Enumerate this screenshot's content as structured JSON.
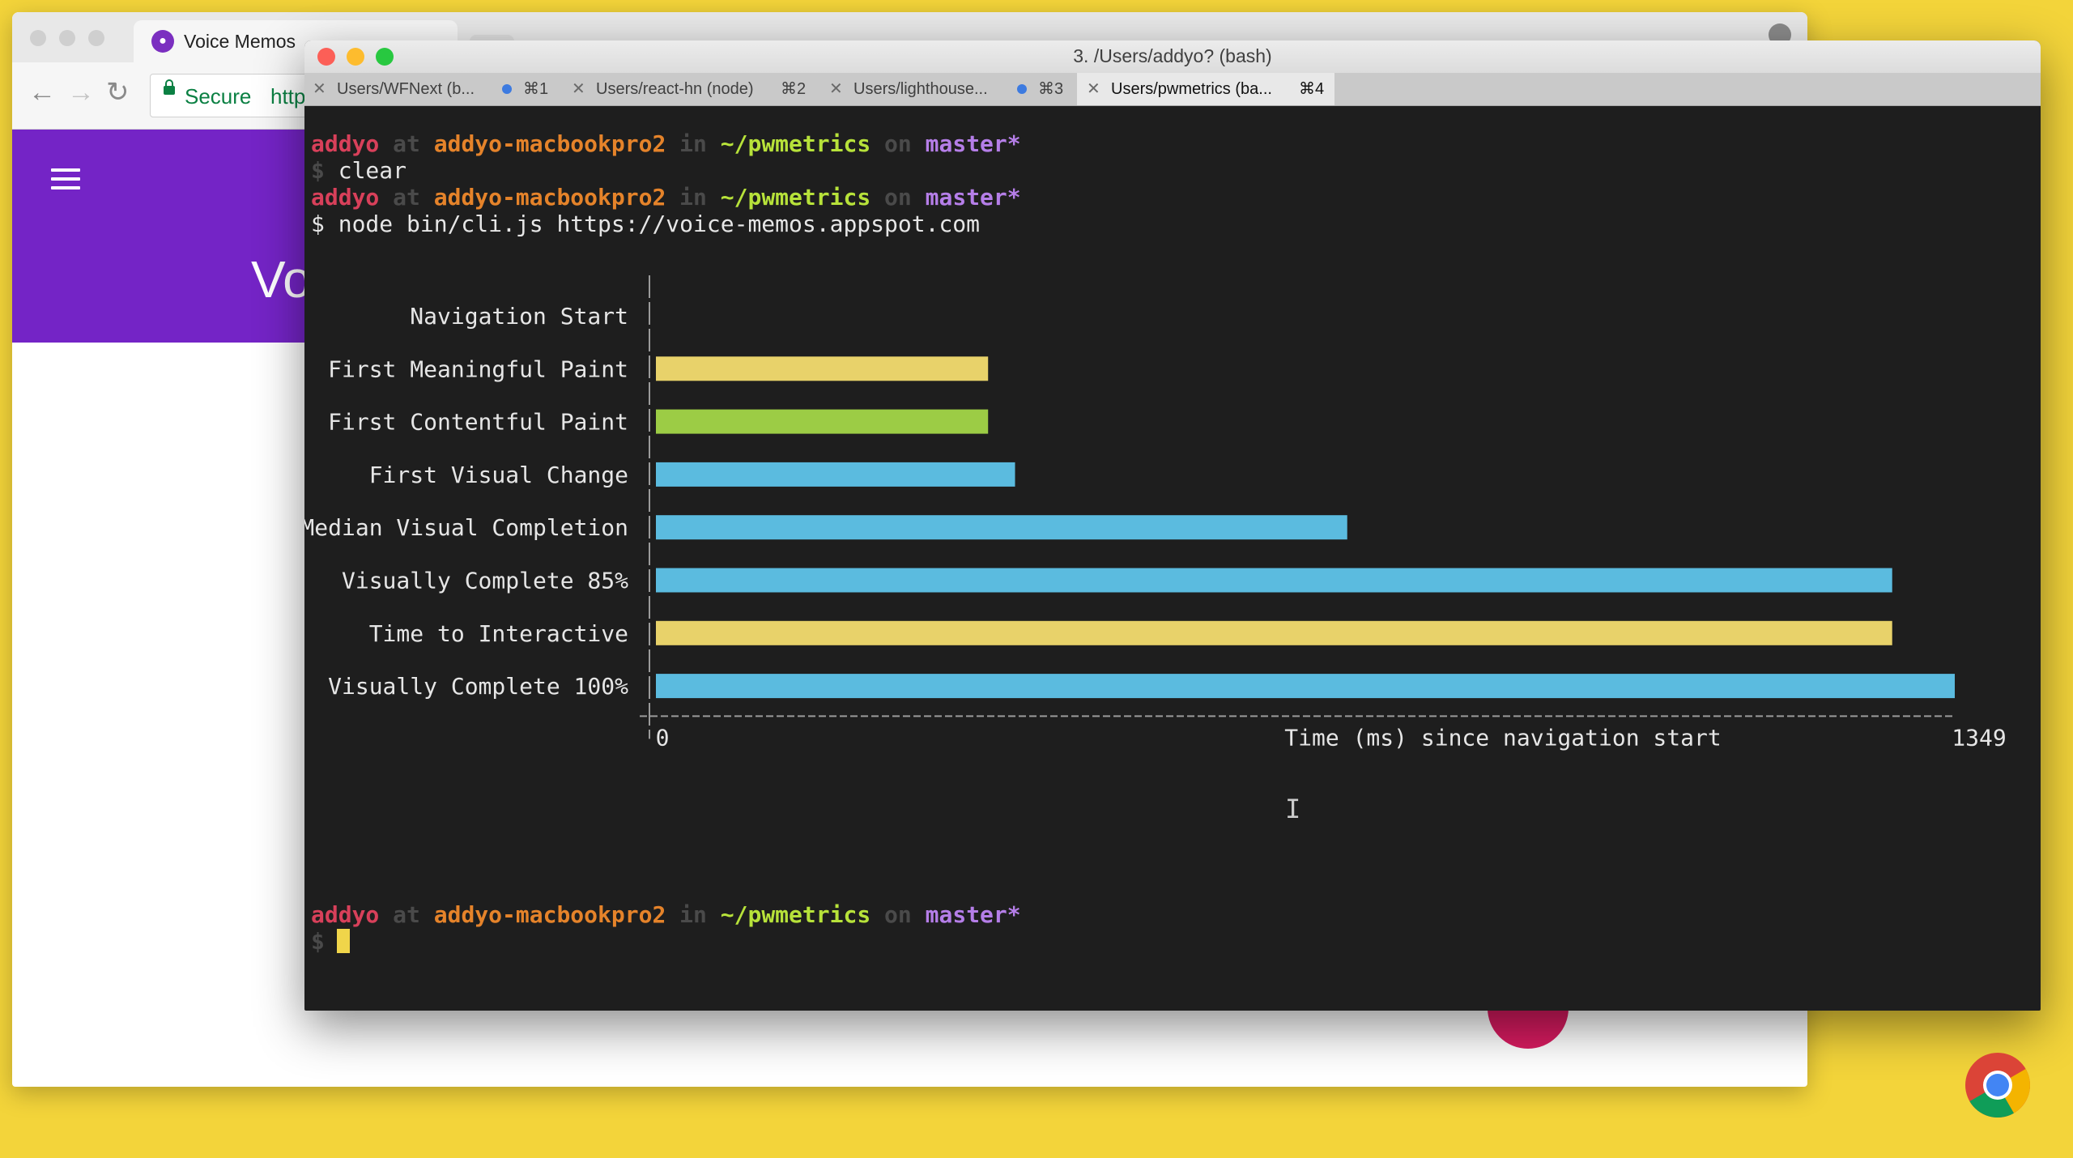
{
  "browser": {
    "tab_title": "Voice Memos",
    "secure_label": "Secure",
    "url_fragment": "http",
    "app_title_fragment": "Vo"
  },
  "terminal": {
    "window_title": "3. /Users/addyo? (bash)",
    "tabs": [
      {
        "label": "Users/WFNext (b...",
        "shortcut": "⌘1",
        "dot": true
      },
      {
        "label": "Users/react-hn (node)",
        "shortcut": "⌘2",
        "dot": false
      },
      {
        "label": "Users/lighthouse...",
        "shortcut": "⌘3",
        "dot": true
      },
      {
        "label": "Users/pwmetrics (ba...",
        "shortcut": "⌘4",
        "dot": false
      }
    ],
    "prompt": {
      "user": "addyo",
      "at": "at",
      "host": "addyo-macbookpro2",
      "in": "in",
      "dir": "~/pwmetrics",
      "on": "on",
      "branch": "master*",
      "symbol": "$"
    },
    "commands": [
      "clear",
      "node bin/cli.js https://voice-memos.appspot.com"
    ]
  },
  "colors": {
    "yellow": "#e8d26a",
    "green": "#9ccc45",
    "blue": "#5bbbdf"
  },
  "chart_data": {
    "type": "bar",
    "orientation": "horizontal",
    "categories": [
      "Navigation Start",
      "First Meaningful Paint",
      "First Contentful Paint",
      "First Visual Change",
      "Median Visual Completion",
      "Visually Complete 85%",
      "Time to Interactive",
      "Visually Complete 100%"
    ],
    "values": [
      0,
      345,
      345,
      373,
      718,
      1284,
      1284,
      1349
    ],
    "bar_colors": [
      "#5bbbdf",
      "#e8d26a",
      "#9ccc45",
      "#5bbbdf",
      "#5bbbdf",
      "#5bbbdf",
      "#e8d26a",
      "#5bbbdf"
    ],
    "xlabel": "Time (ms) since navigation start",
    "xlim": [
      0,
      1349
    ],
    "tick_labels": [
      "0",
      "1349"
    ]
  }
}
